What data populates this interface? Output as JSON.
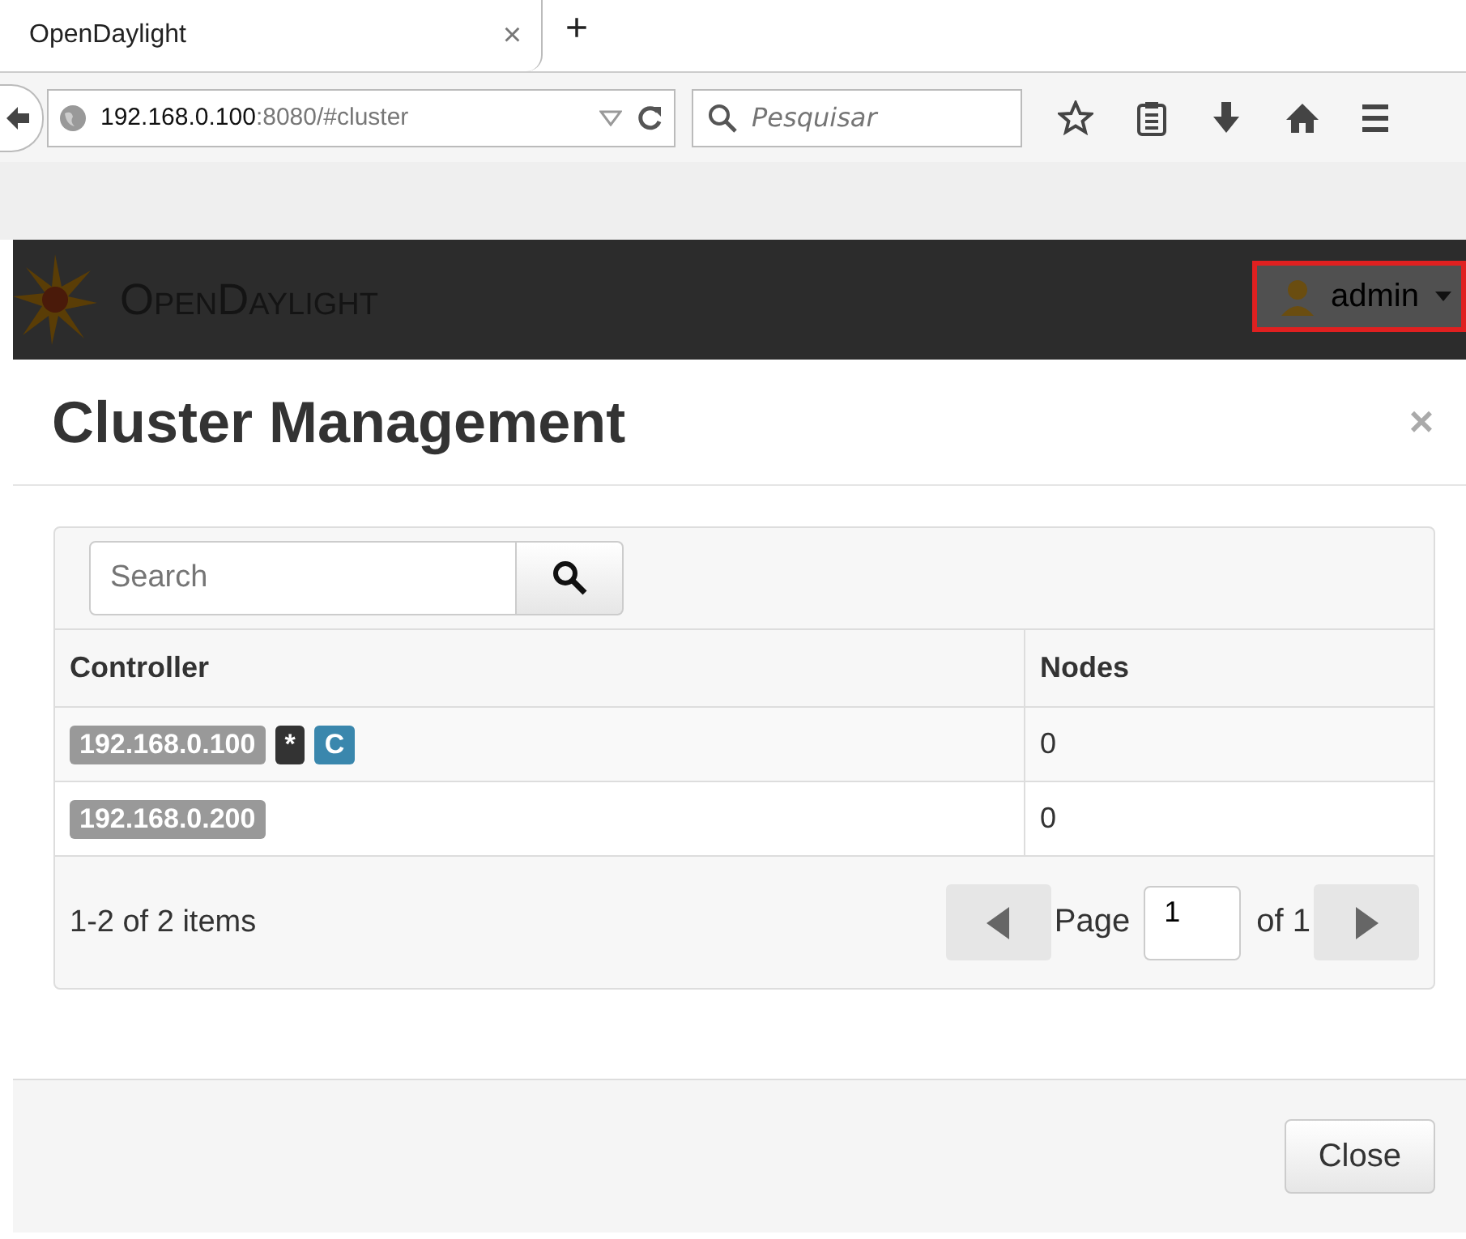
{
  "browser": {
    "tab": {
      "title": "OpenDaylight",
      "close": "×",
      "selected": true
    },
    "new_tab": "+",
    "url": {
      "host": "192.168.0.100",
      "rest": ":8080/#cluster"
    },
    "search": {
      "placeholder": "Pesquisar"
    }
  },
  "app_header": {
    "logo": "OpenDaylight",
    "user": "admin"
  },
  "modal": {
    "title": "Cluster Management",
    "close": "×",
    "search": {
      "placeholder": "Search"
    },
    "table": {
      "columns": [
        "Controller",
        "Nodes"
      ],
      "rows": [
        {
          "badges": [
            {
              "text": "192.168.0.100",
              "color": "#999999"
            },
            {
              "text": "*",
              "color": "#333333"
            },
            {
              "text": "C",
              "color": "#3a87ad"
            }
          ],
          "nodes": "0"
        },
        {
          "badges": [
            {
              "text": "192.168.0.200",
              "color": "#999999"
            }
          ],
          "nodes": "0"
        }
      ]
    },
    "summary": "1-2 of 2 items",
    "pager": {
      "page_label": "Page",
      "page": "1",
      "of_label": "of 1"
    },
    "buttons": [
      "Close"
    ]
  }
}
